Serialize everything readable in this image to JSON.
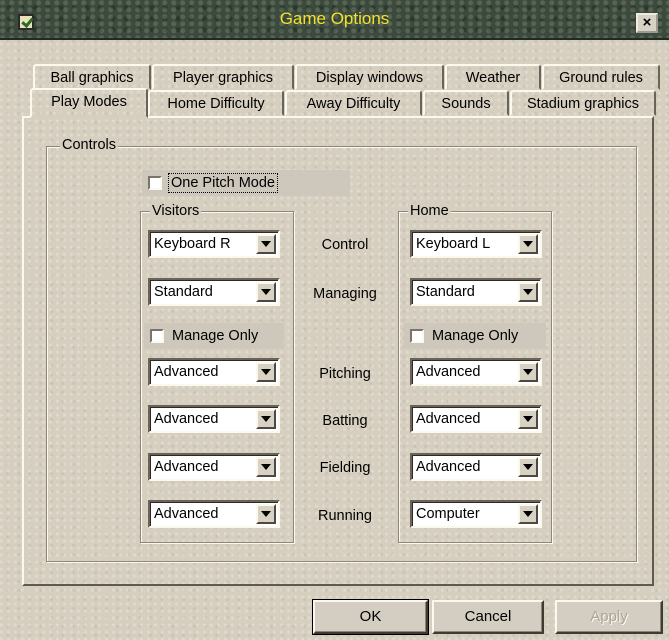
{
  "window": {
    "title": "Game Options",
    "close_glyph": "×"
  },
  "tabs_row1": [
    "Ball graphics",
    "Player graphics",
    "Display windows",
    "Weather",
    "Ground rules"
  ],
  "tabs_row2": [
    "Play Modes",
    "Home Difficulty",
    "Away Difficulty",
    "Sounds",
    "Stadium graphics"
  ],
  "active_tab": "Play Modes",
  "controls": {
    "group_label": "Controls",
    "one_pitch_mode": {
      "label": "One Pitch Mode",
      "checked": false
    },
    "visitors": {
      "label": "Visitors",
      "control": "Keyboard R",
      "managing": "Standard",
      "manage_only": {
        "label": "Manage Only",
        "checked": false
      },
      "pitching": "Advanced",
      "batting": "Advanced",
      "fielding": "Advanced",
      "running": "Advanced"
    },
    "home": {
      "label": "Home",
      "control": "Keyboard L",
      "managing": "Standard",
      "manage_only": {
        "label": "Manage Only",
        "checked": false
      },
      "pitching": "Advanced",
      "batting": "Advanced",
      "fielding": "Advanced",
      "running": "Computer"
    },
    "row_labels": {
      "control": "Control",
      "managing": "Managing",
      "pitching": "Pitching",
      "batting": "Batting",
      "fielding": "Fielding",
      "running": "Running"
    }
  },
  "buttons": {
    "ok": "OK",
    "cancel": "Cancel",
    "apply": "Apply"
  },
  "colors": {
    "title_text": "#f2e230",
    "title_bar": "#3b4a3c",
    "dialog_bg": "#d6cfc0"
  }
}
